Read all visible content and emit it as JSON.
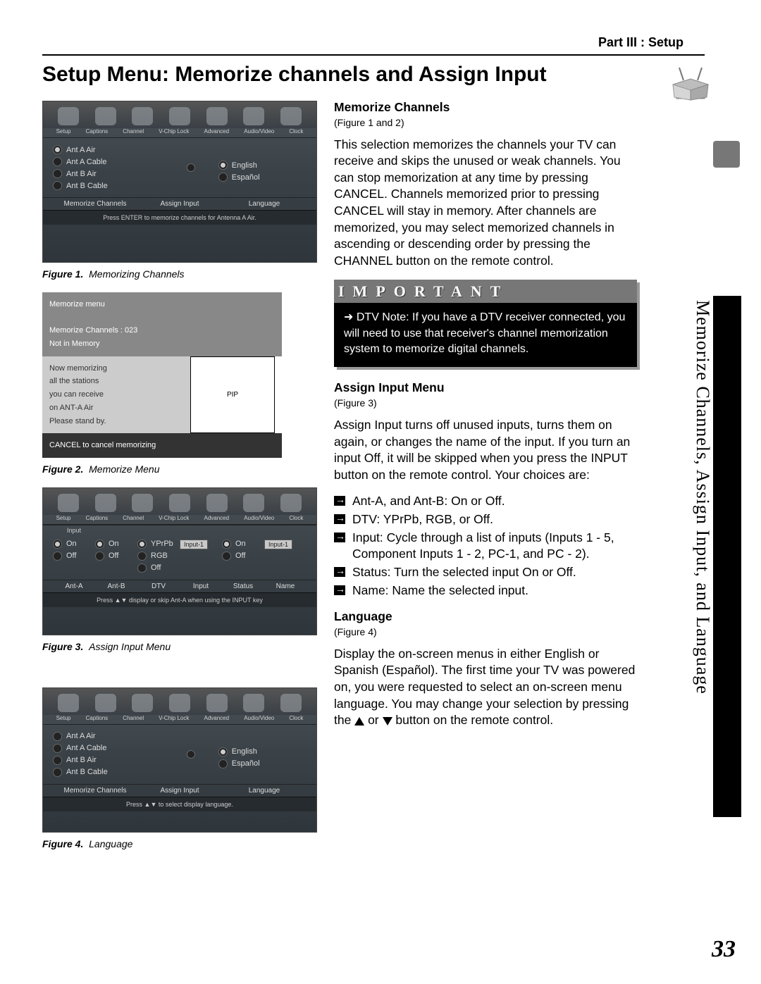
{
  "header": {
    "part": "Part III : Setup"
  },
  "title": "Setup Menu: Memorize channels and Assign Input",
  "side_tab": "Memorize Channels, Assign Input, and Language",
  "page_number": "33",
  "menu_icon_labels": [
    "Setup",
    "Captions",
    "Channel",
    "V-Chip Lock",
    "Advanced",
    "Audio/Video",
    "Clock"
  ],
  "fig1": {
    "panel": {
      "mem_items": [
        "Ant A Air",
        "Ant A Cable",
        "Ant B Air",
        "Ant B Cable"
      ],
      "lang_items": [
        "English",
        "Español"
      ],
      "footers": [
        "Memorize Channels",
        "Assign Input",
        "Language"
      ],
      "hint": "Press ENTER to memorize channels for Antenna A Air."
    },
    "caption_label": "Figure 1.",
    "caption_text": "Memorizing Channels"
  },
  "fig2": {
    "line1": "Memorize  menu",
    "line2": "Memorize  Channels   :   023",
    "line3": "Not   in   Memory",
    "mid1": "Now  memorizing",
    "mid2": "all   the   stations",
    "mid3": "you   can   receive",
    "mid4": "on   ANT-A   Air",
    "mid5": "Please   stand   by.",
    "pip": "PIP",
    "bot": "CANCEL  to  cancel   memorizing",
    "caption_label": "Figure 2.",
    "caption_text": "Memorize Menu"
  },
  "fig3": {
    "row_heads": [
      "Input"
    ],
    "col_labels": [
      "Ant-A",
      "Ant-B",
      "DTV",
      "Input",
      "Status",
      "Name"
    ],
    "on": "On",
    "off": "Off",
    "yprpb": "YPrPb",
    "rgb": "RGB",
    "input1": "Input-1",
    "hint": "Press  ▲▼  display or skip Ant-A when using the INPUT key",
    "caption_label": "Figure 3.",
    "caption_text": "Assign Input Menu"
  },
  "fig4": {
    "mem_items": [
      "Ant A Air",
      "Ant A Cable",
      "Ant B Air",
      "Ant B Cable"
    ],
    "lang_items": [
      "English",
      "Español"
    ],
    "footers": [
      "Memorize Channels",
      "Assign Input",
      "Language"
    ],
    "hint": "Press  ▲▼  to select display language.",
    "caption_label": "Figure 4.",
    "caption_text": "Language"
  },
  "sections": {
    "memorize": {
      "head": "Memorize Channels",
      "figref": "(Figure 1 and 2)",
      "body": "This selection memorizes the channels your TV can receive and skips the unused or weak channels. You can stop memorization at any time by pressing CANCEL. Channels memorized prior to pressing CANCEL will stay in memory. After channels are memo­rized, you may select memorized channels in ascending or descending order by pressing the CHANNEL button on the remote control."
    },
    "important": {
      "title": "IMPORTANT",
      "arrow": "➜",
      "body": "DTV Note: If you have a DTV receiver connected, you will need to use that receiv­er's channel memorization system to memorize digital channels."
    },
    "assign": {
      "head": "Assign Input Menu",
      "figref": "(Figure 3)",
      "body": "Assign Input turns off unused inputs, turns them on again, or changes the name of the input. If you turn an input Off, it will be skipped when you press the INPUT button on the remote control. Your choices are:",
      "items": [
        "Ant-A, and Ant-B: On or Off.",
        "DTV: YPrPb, RGB, or Off.",
        "Input: Cycle through a list of inputs (Inputs 1 - 5, Component Inputs 1 - 2, PC-1, and PC - 2).",
        "Status: Turn the selected input On or Off.",
        "Name: Name the selected input."
      ]
    },
    "language": {
      "head": "Language",
      "figref": "(Figure 4)",
      "body_a": "Display the on-screen menus in either Eng­lish or Spanish (Español). The first time your TV was powered on, you were requested to select an on-screen menu language. You may change your selection by pressing the ",
      "body_b": " or ",
      "body_c": " button on the remote control."
    }
  }
}
